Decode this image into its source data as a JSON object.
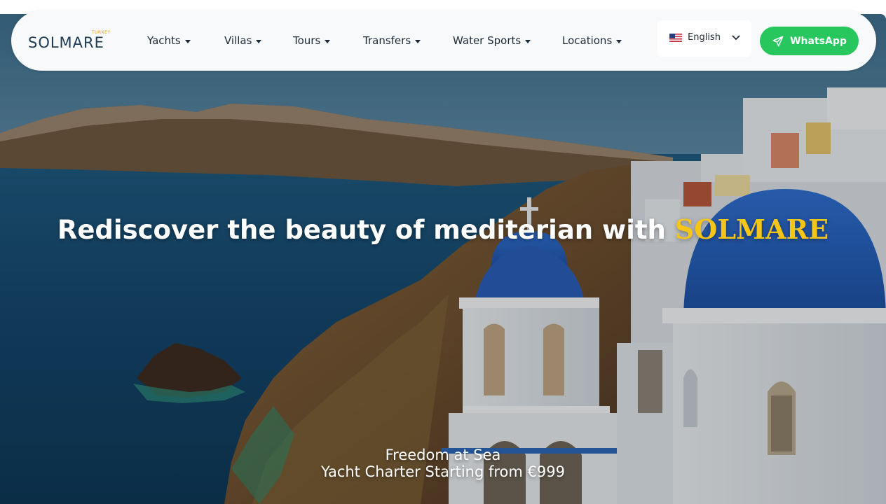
{
  "brand": {
    "name": "SOLMARE",
    "sub_label": "TURKEY"
  },
  "nav": {
    "items": [
      {
        "label": "Yachts"
      },
      {
        "label": "Villas"
      },
      {
        "label": "Tours"
      },
      {
        "label": "Transfers"
      },
      {
        "label": "Water Sports"
      },
      {
        "label": "Locations"
      }
    ]
  },
  "language": {
    "selected": "English",
    "flag_icon": "us-flag-icon"
  },
  "cta": {
    "whatsapp_label": "WhatsApp",
    "icon": "send-icon"
  },
  "hero": {
    "headline_prefix": "Rediscover the beauty of mediterian with ",
    "headline_brand": "SOLMARE",
    "tagline_line1": "Freedom at Sea",
    "tagline_line2": "Yacht Charter Starting from €999"
  },
  "colors": {
    "whatsapp_green": "#27c75d",
    "brand_gold": "#f5c518",
    "navbar_bg": "#f7f9fb",
    "text_dark": "#1d2a38"
  }
}
